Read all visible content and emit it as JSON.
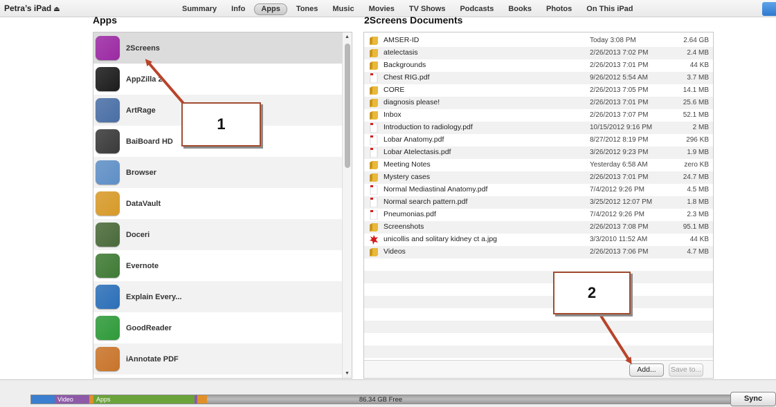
{
  "header": {
    "device_name": "Petra’s iPad",
    "eject_glyph": "⏏",
    "tabs": [
      {
        "label": "Summary",
        "active": false
      },
      {
        "label": "Info",
        "active": false
      },
      {
        "label": "Apps",
        "active": true
      },
      {
        "label": "Tones",
        "active": false
      },
      {
        "label": "Music",
        "active": false
      },
      {
        "label": "Movies",
        "active": false
      },
      {
        "label": "TV Shows",
        "active": false
      },
      {
        "label": "Podcasts",
        "active": false
      },
      {
        "label": "Books",
        "active": false
      },
      {
        "label": "Photos",
        "active": false
      },
      {
        "label": "On This iPad",
        "active": false
      }
    ]
  },
  "apps": {
    "title": "Apps",
    "items": [
      {
        "name": "2Screens",
        "icon": "2screens-icon",
        "color": "#9b2aa3",
        "selected": true
      },
      {
        "name": "AppZilla 2",
        "icon": "appzilla-icon",
        "color": "#1c1c1c",
        "selected": false
      },
      {
        "name": "ArtRage",
        "icon": "artrage-icon",
        "color": "#4a6fa5",
        "selected": false
      },
      {
        "name": "BaiBoard HD",
        "icon": "baiboard-icon",
        "color": "#3a3a3a",
        "selected": false
      },
      {
        "name": "Browser",
        "icon": "browser-icon",
        "color": "#5f8fc6",
        "selected": false
      },
      {
        "name": "DataVault",
        "icon": "datavault-icon",
        "color": "#d79a2a",
        "selected": false
      },
      {
        "name": "Doceri",
        "icon": "doceri-icon",
        "color": "#4a6a3a",
        "selected": false
      },
      {
        "name": "Evernote",
        "icon": "evernote-icon",
        "color": "#3f7a35",
        "selected": false
      },
      {
        "name": "Explain Every...",
        "icon": "explain-everything-icon",
        "color": "#2c6fb8",
        "selected": false
      },
      {
        "name": "GoodReader",
        "icon": "goodreader-icon",
        "color": "#2f9a3a",
        "selected": false
      },
      {
        "name": "iAnnotate PDF",
        "icon": "iannotate-icon",
        "color": "#c8742a",
        "selected": false
      }
    ]
  },
  "documents": {
    "title": "2Screens Documents",
    "rows": [
      {
        "name": "AMSER-ID",
        "date": "Today 3:08 PM",
        "size": "2.64 GB",
        "type": "folder"
      },
      {
        "name": "atelectasis",
        "date": "2/26/2013 7:02 PM",
        "size": "2.4 MB",
        "type": "folder"
      },
      {
        "name": "Backgrounds",
        "date": "2/26/2013 7:01 PM",
        "size": "44 KB",
        "type": "folder"
      },
      {
        "name": "Chest RIG.pdf",
        "date": "9/26/2012 5:54 AM",
        "size": "3.7 MB",
        "type": "pdf"
      },
      {
        "name": "CORE",
        "date": "2/26/2013 7:05 PM",
        "size": "14.1 MB",
        "type": "folder"
      },
      {
        "name": "diagnosis please!",
        "date": "2/26/2013 7:01 PM",
        "size": "25.6 MB",
        "type": "folder"
      },
      {
        "name": "Inbox",
        "date": "2/26/2013 7:07 PM",
        "size": "52.1 MB",
        "type": "folder"
      },
      {
        "name": "Introduction to radiology.pdf",
        "date": "10/15/2012 9:16 PM",
        "size": "2 MB",
        "type": "pdf"
      },
      {
        "name": "Lobar Anatomy.pdf",
        "date": "8/27/2012 8:19 PM",
        "size": "296 KB",
        "type": "pdf"
      },
      {
        "name": "Lobar Atelectasis.pdf",
        "date": "3/26/2012 9:23 PM",
        "size": "1.9 MB",
        "type": "pdf"
      },
      {
        "name": "Meeting Notes",
        "date": "Yesterday 6:58 AM",
        "size": "zero KB",
        "type": "folder"
      },
      {
        "name": "Mystery cases",
        "date": "2/26/2013 7:01 PM",
        "size": "24.7 MB",
        "type": "folder"
      },
      {
        "name": "Normal Mediastinal Anatomy.pdf",
        "date": "7/4/2012 9:26 PM",
        "size": "4.5 MB",
        "type": "pdf"
      },
      {
        "name": "Normal search pattern.pdf",
        "date": "3/25/2012 12:07 PM",
        "size": "1.8 MB",
        "type": "pdf"
      },
      {
        "name": "Pneumonias.pdf",
        "date": "7/4/2012 9:26 PM",
        "size": "2.3 MB",
        "type": "pdf"
      },
      {
        "name": "Screenshots",
        "date": "2/26/2013 7:08 PM",
        "size": "95.1 MB",
        "type": "folder"
      },
      {
        "name": "unicollis and solitary kidney ct a.jpg",
        "date": "3/3/2010 11:52 AM",
        "size": "44 KB",
        "type": "image"
      },
      {
        "name": "Videos",
        "date": "2/26/2013 7:06 PM",
        "size": "4.7 MB",
        "type": "folder"
      }
    ],
    "add_label": "Add...",
    "save_label": "Save to..."
  },
  "annotations": {
    "callout_1": "1",
    "callout_2": "2",
    "arrow_color": "#b8442a"
  },
  "capacity": {
    "video_label": "Video",
    "apps_label": "Apps",
    "free_label": "86.34 GB Free",
    "colors": {
      "audio": "#3a7fd0",
      "video": "#8e5aa8",
      "apps": "#6aa33a",
      "other": "#e0902a",
      "free": "#a8a8a8"
    }
  },
  "sync": {
    "label": "Sync"
  }
}
